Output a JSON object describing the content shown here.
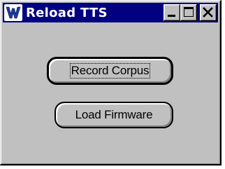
{
  "window": {
    "title": "Reload TTS",
    "title_bar_color": "#000080",
    "face_color": "#c0c0c0",
    "controls": [
      "minimize-icon",
      "maximize-icon",
      "close-icon"
    ]
  },
  "buttons": {
    "record_corpus_label": "Record Corpus",
    "load_firmware_label": "Load Firmware"
  }
}
